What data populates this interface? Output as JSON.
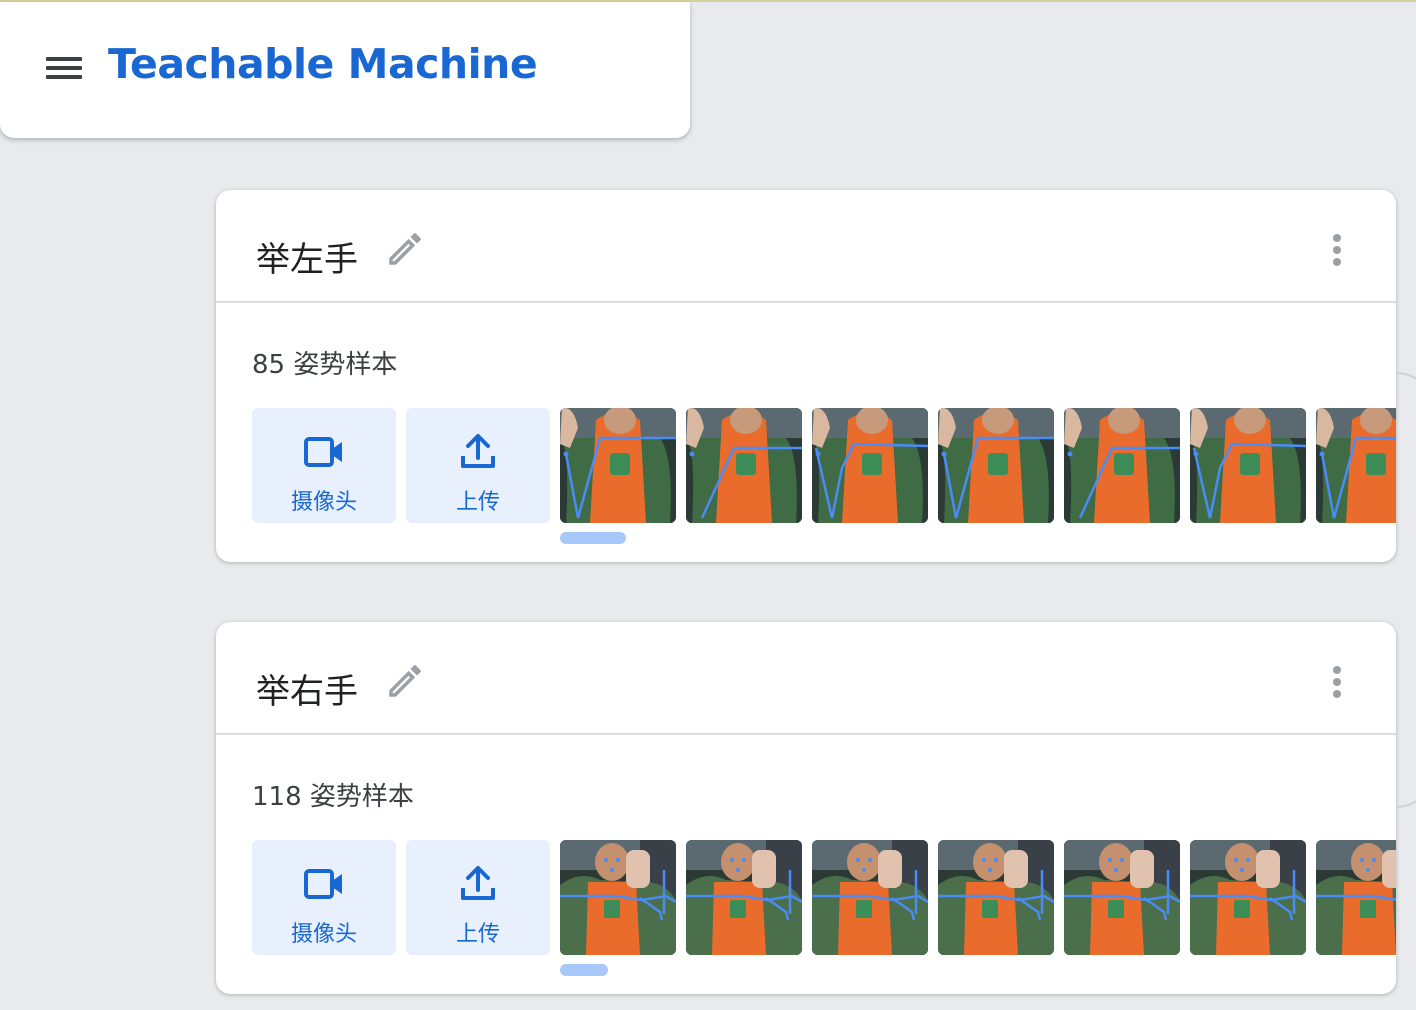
{
  "app": {
    "title": "Teachable Machine"
  },
  "classes": [
    {
      "name": "举左手",
      "sample_count": "85 姿势样本",
      "webcam_label": "摄像头",
      "upload_label": "上传",
      "pose": "left",
      "thumbnail_count": 7
    },
    {
      "name": "举右手",
      "sample_count": "118 姿势样本",
      "webcam_label": "摄像头",
      "upload_label": "上传",
      "pose": "right",
      "thumbnail_count": 7
    }
  ],
  "icons": {
    "menu": "hamburger-menu-icon",
    "edit": "pencil-icon",
    "more": "more-vert-icon",
    "webcam": "videocam-icon",
    "upload": "upload-icon"
  },
  "colors": {
    "brand": "#1967d2",
    "button_bg": "#e8f0fe",
    "scroll_indicator": "#a8c7fa",
    "background": "#e8eaed"
  }
}
